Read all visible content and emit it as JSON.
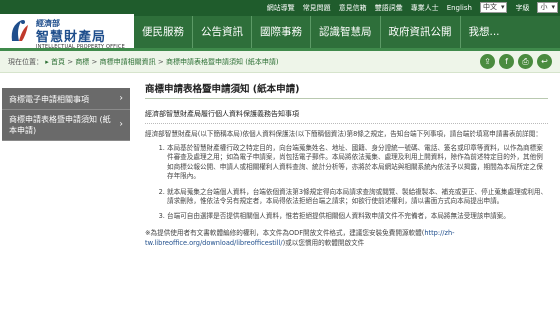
{
  "top_bar": {
    "links": [
      "網站導覽",
      "常見問題",
      "意見信箱",
      "雙語詞彙",
      "專業人士",
      "English"
    ],
    "language_select": "中文",
    "font_size_label": "字級",
    "font_size_select": "小"
  },
  "logo": {
    "small": "經濟部",
    "big": "智慧財產局",
    "en": "INTELLECTUAL PROPERTY OFFICE",
    "mark": "TIPO"
  },
  "nav": [
    "便民服務",
    "公告資訊",
    "國際事務",
    "認識智慧局",
    "政府資訊公開",
    "我想..."
  ],
  "breadcrumb": {
    "prefix": "現在位置：",
    "items": [
      "首頁",
      "商標",
      "商標申請相關資訊",
      "商標申請表格暨申請須知 (紙本申請)"
    ],
    "sep": " > "
  },
  "sidebar": [
    {
      "label": "商標電子申請相關事項"
    },
    {
      "label": "商標申請表格暨申請須知 (紙本申請)"
    }
  ],
  "content": {
    "title": "商標申請表格暨申請須知 (紙本申請)",
    "subtitle": "經濟部智慧財產局履行個人資料保護義務告知事項",
    "intro": "經濟部智慧財產局(以下簡稱本局)依個人資料保護法(以下簡稱個資法)第8條之規定，告知台端下列事項，請台端於填寫申請書表前詳閱：",
    "items": [
      "本局基於智慧財產權行政之特定目的，向台端蒐集姓名、地址、國籍、身分證統一號碼、電話、簽名或印章等資料，以作為商標案件審查及處理之用；如為電子申請案，尚包括電子郵件。本局將依法蒐集、處理及利用上開資料，除作為前述特定目的外，其他例如商標公報公開、申請人或相關權利人資料查詢、統計分析等，亦將於本局網站與相關系統內依法予以揭露，期間為本局所定之保存年限內。",
      "就本局蒐集之台端個人資料，台端依個資法第3條規定得向本局請求查詢或閱覽、製給複製本、補充或更正、停止蒐集處理或利用、請求刪除，惟依法令另有規定者，本局得依法拒絕台端之請求；如欲行使前述權利，請以書面方式向本局提出申請。",
      "台端可自由選擇是否提供相關個人資料，惟若拒絕提供相關個人資料致申請文件不完備者，本局將無法受理該申請案。"
    ],
    "note_text": "※為提供使用者有文書軟體編修的權利，本文件為ODF開放文件格式，建議您安裝免費開源軟體(",
    "note_url": "http://zh-tw.libreoffice.org/download/libreofficestill/",
    "note_tail": ")或以您慣用的軟體開啟文件"
  },
  "colors": {
    "nav_bg": "#2e6f3a",
    "util_bg": "#1f5c2c",
    "sidebar_bg": "#6a6a6a",
    "crumb_bg": "#eef5e9",
    "link": "#1f4e8c"
  }
}
